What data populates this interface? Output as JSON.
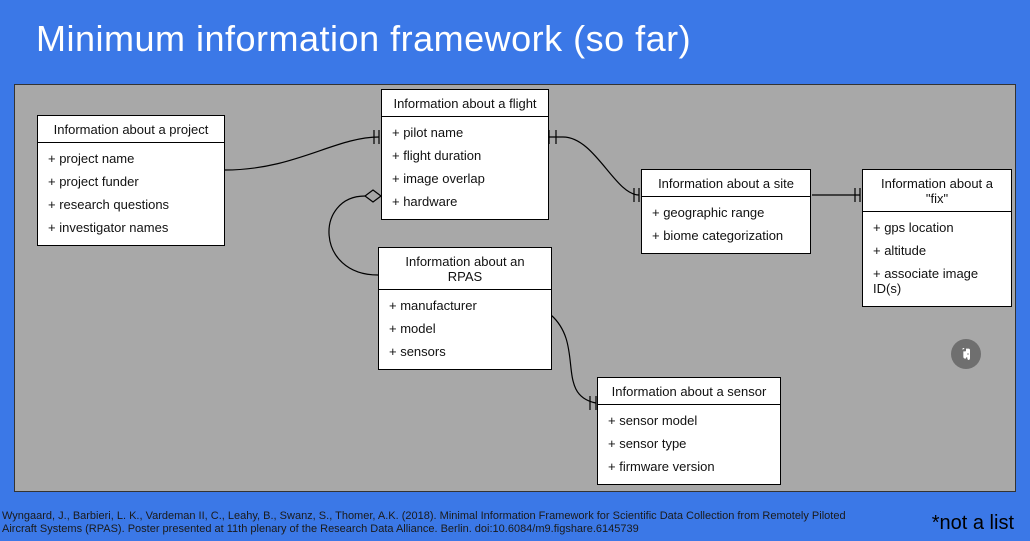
{
  "title": "Minimum information framework (so far)",
  "boxes": {
    "project": {
      "title": "Information about a project",
      "attrs": [
        "+ project name",
        "+ project funder",
        "+ research questions",
        "+ investigator names"
      ]
    },
    "flight": {
      "title": "Information about a flight",
      "attrs": [
        "+ pilot name",
        "+ flight duration",
        "+ image overlap",
        "+ hardware"
      ]
    },
    "site": {
      "title": "Information about a site",
      "attrs": [
        "+ geographic range",
        "+ biome categorization"
      ]
    },
    "fix": {
      "title": "Information about a \"fix\"",
      "attrs": [
        "+ gps location",
        "+ altitude",
        "+ associate image ID(s)"
      ]
    },
    "rpas": {
      "title": "Information about an RPAS",
      "attrs": [
        "+ manufacturer",
        "+ model",
        "+ sensors"
      ]
    },
    "sensor": {
      "title": "Information about a sensor",
      "attrs": [
        "+ sensor model",
        "+ sensor type",
        "+ firmware version"
      ]
    }
  },
  "citation": "Wyngaard, J., Barbieri, L. K., Vardeman II, C., Leahy, B., Swanz, S., Thomer, A.K. (2018). Minimal Information Framework for Scientific Data Collection from Remotely Piloted Aircraft Systems (RPAS). Poster presented at 11th plenary of the Research Data Alliance. Berlin. doi:10.6084/m9.figshare.6145739",
  "footnote": "*not a list",
  "chart_data": {
    "type": "diagram",
    "title": "Minimum information framework (so far)",
    "entities": [
      {
        "id": "project",
        "label": "Information about a project",
        "attributes": [
          "project name",
          "project funder",
          "research questions",
          "investigator names"
        ]
      },
      {
        "id": "flight",
        "label": "Information about a flight",
        "attributes": [
          "pilot name",
          "flight duration",
          "image overlap",
          "hardware"
        ]
      },
      {
        "id": "site",
        "label": "Information about a site",
        "attributes": [
          "geographic range",
          "biome categorization"
        ]
      },
      {
        "id": "fix",
        "label": "Information about a \"fix\"",
        "attributes": [
          "gps location",
          "altitude",
          "associate image ID(s)"
        ]
      },
      {
        "id": "rpas",
        "label": "Information about an RPAS",
        "attributes": [
          "manufacturer",
          "model",
          "sensors"
        ]
      },
      {
        "id": "sensor",
        "label": "Information about a sensor",
        "attributes": [
          "sensor model",
          "sensor type",
          "firmware version"
        ]
      }
    ],
    "relations": [
      {
        "from": "project",
        "to": "flight",
        "type": "one-to-many"
      },
      {
        "from": "flight",
        "to": "site",
        "type": "one-to-many"
      },
      {
        "from": "flight",
        "to": "rpas",
        "type": "aggregation"
      },
      {
        "from": "site",
        "to": "fix",
        "type": "one-to-many"
      },
      {
        "from": "rpas",
        "to": "sensor",
        "type": "one-to-many"
      }
    ]
  }
}
